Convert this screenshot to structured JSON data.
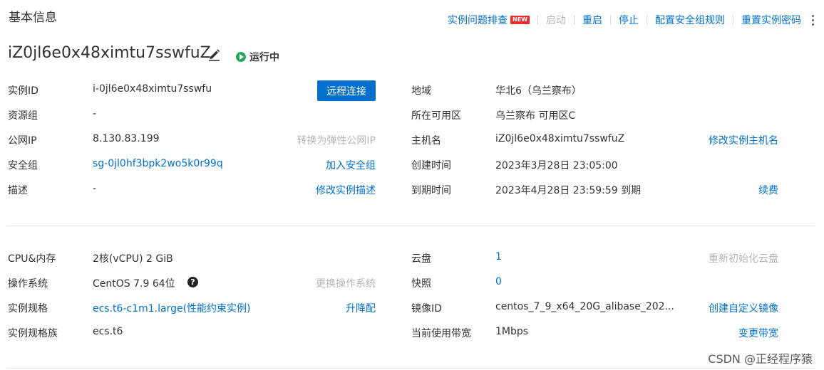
{
  "section": {
    "title": "基本信息"
  },
  "toolbar": {
    "troubleshoot": "实例问题排查",
    "new_badge": "NEW",
    "start": "启动",
    "restart": "重启",
    "stop": "停止",
    "sg_rules": "配置安全组规则",
    "reset_password": "重置实例密码"
  },
  "instance": {
    "name": "iZ0jl6e0x48ximtu7sswfuZ",
    "status": "运行中"
  },
  "basic": {
    "instance_id": {
      "label": "实例ID",
      "value": "i-0jl6e0x48ximtu7sswfu",
      "action": "远程连接"
    },
    "resource_group": {
      "label": "资源组",
      "value": "-"
    },
    "public_ip": {
      "label": "公网IP",
      "value": "8.130.83.199",
      "action": "转换为弹性公网IP"
    },
    "security_group": {
      "label": "安全组",
      "value": "sg-0jl0hf3bpk2wo5k0r99q",
      "action": "加入安全组"
    },
    "description": {
      "label": "描述",
      "value": "-",
      "action": "修改实例描述"
    },
    "region": {
      "label": "地域",
      "value": "华北6（乌兰察布）"
    },
    "zone": {
      "label": "所在可用区",
      "value": "乌兰察布 可用区C"
    },
    "hostname": {
      "label": "主机名",
      "value": "iZ0jl6e0x48ximtu7sswfuZ",
      "action": "修改实例主机名"
    },
    "created": {
      "label": "创建时间",
      "value": "2023年3月28日 23:05:00"
    },
    "expires": {
      "label": "到期时间",
      "value": "2023年4月28日 23:59:59 到期",
      "action": "续费"
    }
  },
  "config": {
    "cpu_mem": {
      "label": "CPU&内存",
      "value": "2核(vCPU) 2 GiB"
    },
    "os": {
      "label": "操作系统",
      "value": "CentOS 7.9 64位",
      "help": "?",
      "action": "更换操作系统"
    },
    "spec": {
      "label": "实例规格",
      "value": "ecs.t6-c1m1.large(性能约束实例)",
      "action": "升降配"
    },
    "spec_family": {
      "label": "实例规格族",
      "value": "ecs.t6"
    },
    "disk": {
      "label": "云盘",
      "value": "1",
      "action": "重新初始化云盘"
    },
    "snapshot": {
      "label": "快照",
      "value": "0"
    },
    "image": {
      "label": "镜像ID",
      "value": "centos_7_9_x64_20G_alibase_202...",
      "action": "创建自定义镜像"
    },
    "bandwidth": {
      "label": "当前使用带宽",
      "value": "1Mbps",
      "action": "变更带宽"
    }
  },
  "watermark": "CSDN @正经程序猿",
  "colors": {
    "link": "#0070cc",
    "primary": "#0070cc",
    "running": "#25a55a",
    "disabled": "#b5b5b5",
    "new_badge": "#e62e2e"
  }
}
